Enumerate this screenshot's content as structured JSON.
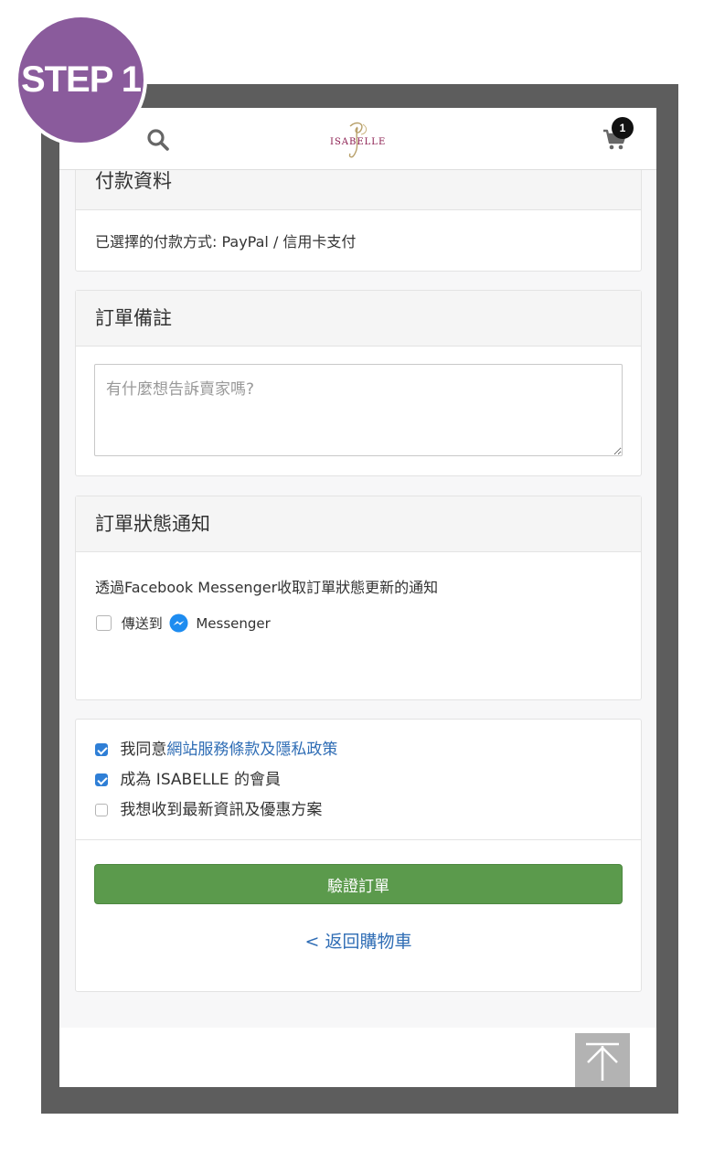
{
  "badge": {
    "step_label": "STEP 1"
  },
  "header": {
    "logo_text": "ISABELLE",
    "cart_count": "1"
  },
  "payment": {
    "title": "付款資料",
    "selected_method": "已選擇的付款方式: PayPal / 信用卡支付"
  },
  "order_note": {
    "title": "訂單備註",
    "placeholder": "有什麼想告訴賣家嗎?",
    "value": ""
  },
  "notification": {
    "title": "訂單狀態通知",
    "description": "透過Facebook Messenger收取訂單狀態更新的通知",
    "send_to_label": "傳送到",
    "messenger_label": "Messenger",
    "send_checked": false
  },
  "agreements": {
    "agree_prefix": "我同意",
    "terms_link": "網站服務條款及隱私政策",
    "agree_checked": true,
    "member_label": "成為 ISABELLE 的會員",
    "member_checked": true,
    "newsletter_label": "我想收到最新資訊及優惠方案",
    "newsletter_checked": false
  },
  "actions": {
    "verify_label": "驗證訂單",
    "back_label": "< 返回購物車"
  },
  "colors": {
    "accent_green": "#5b9a4c",
    "link_blue": "#2f6db5",
    "checkbox_blue": "#2f7fd6",
    "badge_purple": "#8a5b9c",
    "frame_gray": "#5d5d5d"
  }
}
